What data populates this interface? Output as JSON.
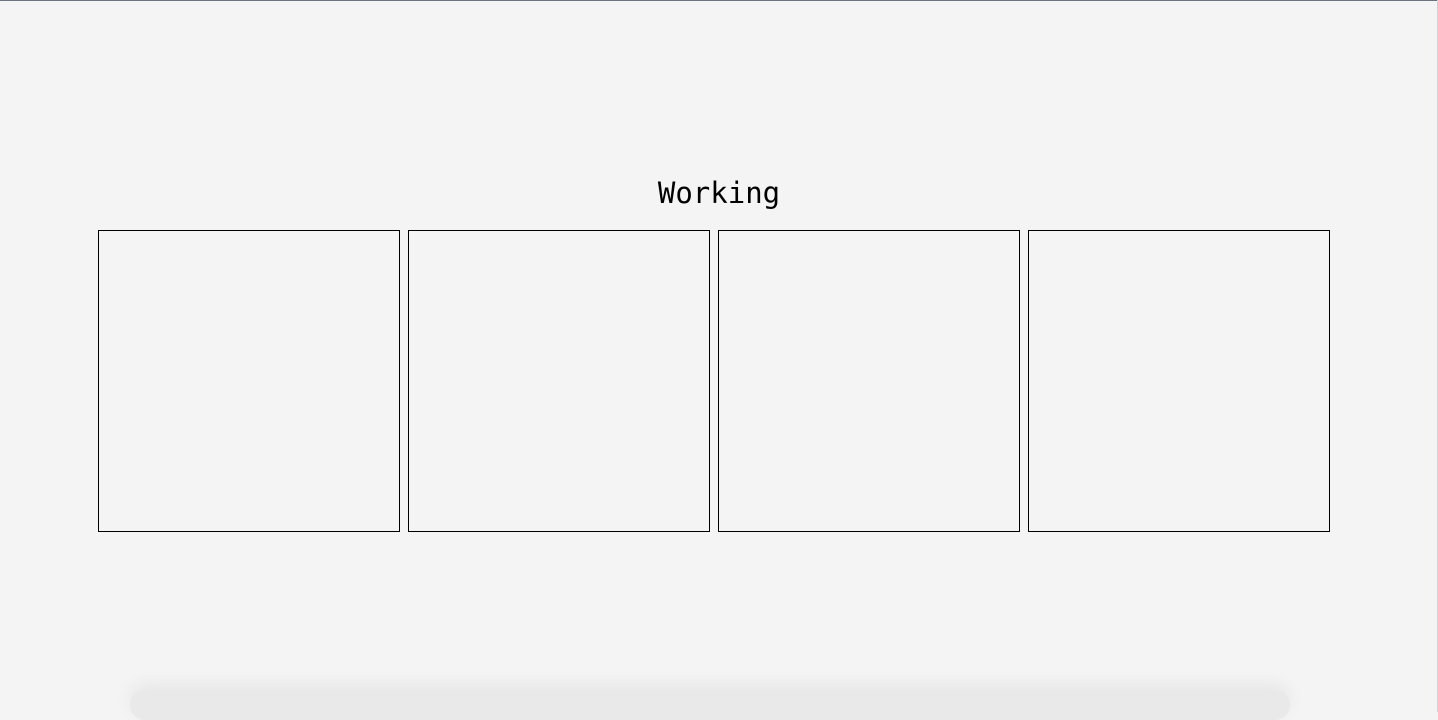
{
  "header": {
    "title": "Working"
  },
  "panels": [
    {
      "id": "panel-1"
    },
    {
      "id": "panel-2"
    },
    {
      "id": "panel-3"
    },
    {
      "id": "panel-4"
    }
  ],
  "colors": {
    "background": "#f4f4f5",
    "border": "#000000",
    "text": "#000000"
  }
}
